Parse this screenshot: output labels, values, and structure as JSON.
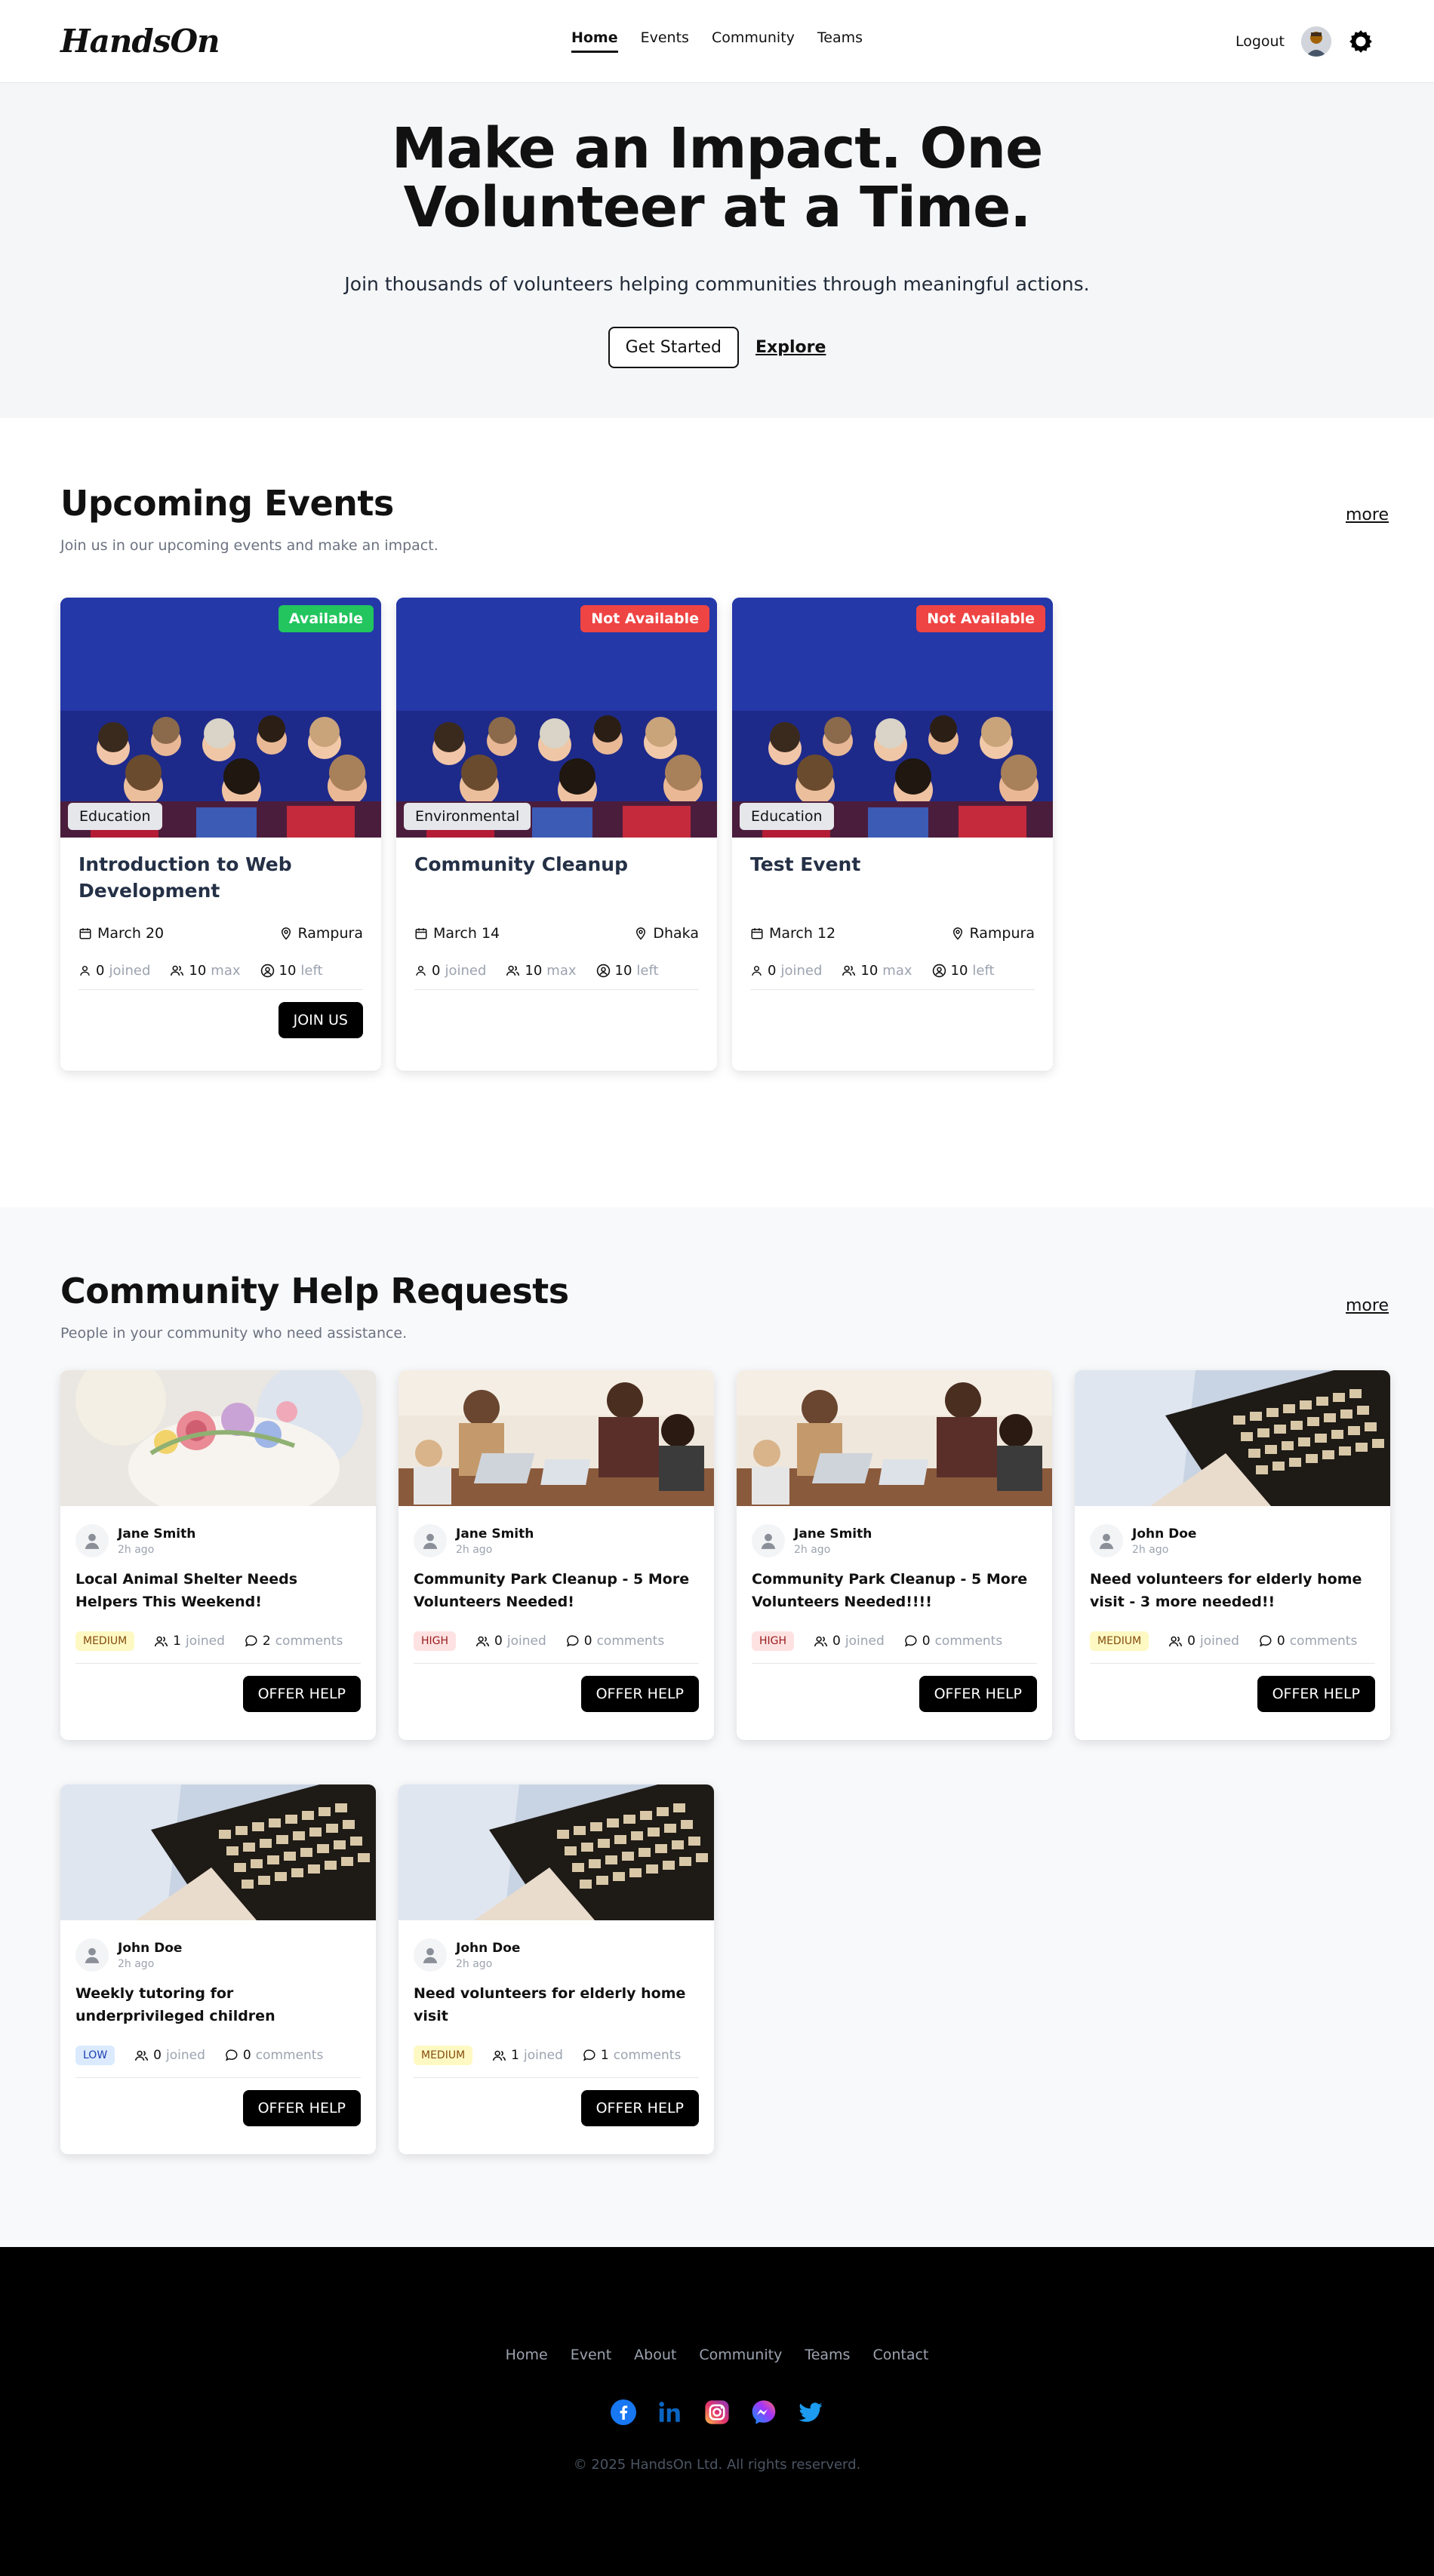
{
  "nav": {
    "logo": "HandsOn",
    "links": [
      {
        "label": "Home",
        "active": true
      },
      {
        "label": "Events",
        "active": false
      },
      {
        "label": "Community",
        "active": false
      },
      {
        "label": "Teams",
        "active": false
      }
    ],
    "logout": "Logout",
    "settings_icon": "gear-icon"
  },
  "hero": {
    "title": "Make an Impact. One Volunteer at a Time.",
    "subtitle": "Join thousands of volunteers helping communities through meaningful actions.",
    "primary_cta": "Get Started",
    "secondary_cta": "Explore"
  },
  "events": {
    "title": "Upcoming Events",
    "subtitle": "Join us in our upcoming events and make an impact.",
    "more": "more",
    "items": [
      {
        "status": "Available",
        "status_type": "available",
        "category": "Education",
        "title": "Introduction to Web Development",
        "date": "March 20",
        "location": "Rampura",
        "joined": "0",
        "joined_label": "joined",
        "max": "10",
        "max_label": "max",
        "left": "10",
        "left_label": "left",
        "action": "JOIN US"
      },
      {
        "status": "Not Available",
        "status_type": "unavailable",
        "category": "Environmental",
        "title": "Community Cleanup",
        "date": "March 14",
        "location": "Dhaka",
        "joined": "0",
        "joined_label": "joined",
        "max": "10",
        "max_label": "max",
        "left": "10",
        "left_label": "left",
        "action": ""
      },
      {
        "status": "Not Available",
        "status_type": "unavailable",
        "category": "Education",
        "title": "Test Event",
        "date": "March 12",
        "location": "Rampura",
        "joined": "0",
        "joined_label": "joined",
        "max": "10",
        "max_label": "max",
        "left": "10",
        "left_label": "left",
        "action": ""
      }
    ]
  },
  "help": {
    "title": "Community Help Requests",
    "subtitle": "People in your community who need assistance.",
    "more": "more",
    "items": [
      {
        "image": "flowers",
        "author": "Jane Smith",
        "time": "2h ago",
        "title": "Local Animal Shelter Needs Helpers This Weekend!",
        "urgency": "MEDIUM",
        "urgency_type": "medium",
        "joined": "1",
        "joined_label": "joined",
        "comments": "2",
        "comments_label": "comments",
        "action": "OFFER HELP"
      },
      {
        "image": "meeting",
        "author": "Jane Smith",
        "time": "2h ago",
        "title": "Community Park Cleanup - 5 More Volunteers Needed!",
        "urgency": "HIGH",
        "urgency_type": "high",
        "joined": "0",
        "joined_label": "joined",
        "comments": "0",
        "comments_label": "comments",
        "action": "OFFER HELP"
      },
      {
        "image": "meeting",
        "author": "Jane Smith",
        "time": "2h ago",
        "title": "Community Park Cleanup - 5 More Volunteers Needed!!!!",
        "urgency": "HIGH",
        "urgency_type": "high",
        "joined": "0",
        "joined_label": "joined",
        "comments": "0",
        "comments_label": "comments",
        "action": "OFFER HELP"
      },
      {
        "image": "laptop",
        "author": "John Doe",
        "time": "2h ago",
        "title": "Need volunteers for elderly home visit - 3 more needed!!",
        "urgency": "MEDIUM",
        "urgency_type": "medium",
        "joined": "0",
        "joined_label": "joined",
        "comments": "0",
        "comments_label": "comments",
        "action": "OFFER HELP"
      },
      {
        "image": "laptop",
        "author": "John Doe",
        "time": "2h ago",
        "title": "Weekly tutoring for underprivileged children",
        "urgency": "LOW",
        "urgency_type": "low",
        "joined": "0",
        "joined_label": "joined",
        "comments": "0",
        "comments_label": "comments",
        "action": "OFFER HELP"
      },
      {
        "image": "laptop",
        "author": "John Doe",
        "time": "2h ago",
        "title": "Need volunteers for elderly home visit",
        "urgency": "MEDIUM",
        "urgency_type": "medium",
        "joined": "1",
        "joined_label": "joined",
        "comments": "1",
        "comments_label": "comments",
        "action": "OFFER HELP"
      }
    ]
  },
  "footer": {
    "links": [
      "Home",
      "Event",
      "About",
      "Community",
      "Teams",
      "Contact"
    ],
    "socials": [
      "facebook-icon",
      "linkedin-icon",
      "instagram-icon",
      "messenger-icon",
      "twitter-icon"
    ],
    "copyright": "© 2025 HandsOn Ltd. All rights reserverd."
  },
  "colors": {
    "available": "#22c55e",
    "unavailable": "#ef4444",
    "primary": "#000000",
    "hero_bg": "#f5f6f8"
  }
}
